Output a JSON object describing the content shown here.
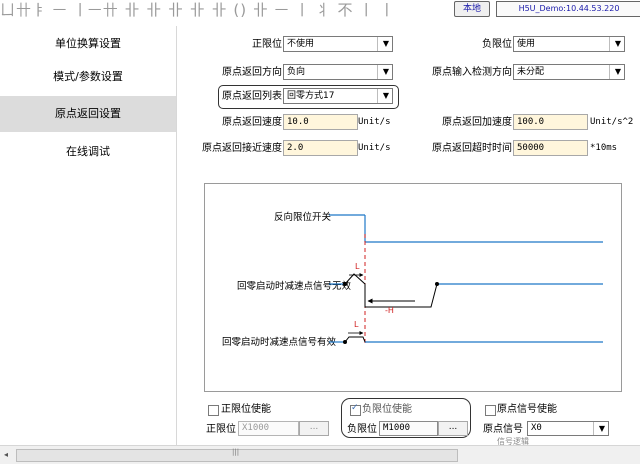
{
  "topbar": {
    "glyph_strip": "ㄩ卄ㅑ ㅡ ㅣㅡ卄 卝 卝 卝 卝 卝 () 卝 ㅡ ㅣ 丬 不 ㅣ ㅣ",
    "local_button": "本地",
    "device_label": "H5U_Demo:10.44.53.220"
  },
  "sidebar": {
    "items": [
      {
        "label": "单位换算设置"
      },
      {
        "label": "模式/参数设置"
      },
      {
        "label": "原点返回设置"
      },
      {
        "label": "在线调试"
      }
    ],
    "active_index": 2
  },
  "form": {
    "pos_limit_label": "正限位",
    "pos_limit_value": "不使用",
    "neg_limit_label": "负限位",
    "neg_limit_value": "使用",
    "home_dir_label": "原点返回方向",
    "home_dir_value": "负向",
    "origin_input_dir_label": "原点输入检测方向",
    "origin_input_dir_value": "未分配",
    "home_list_label": "原点返回列表",
    "home_list_value": "回零方式17",
    "home_speed_label": "原点返回速度",
    "home_speed_value": "10.0",
    "home_speed_unit": "Unit/s",
    "home_accel_label": "原点返回加速度",
    "home_accel_value": "100.0",
    "home_accel_unit": "Unit/s^2",
    "approach_speed_label": "原点返回接近速度",
    "approach_speed_value": "2.0",
    "approach_speed_unit": "Unit/s",
    "timeout_label": "原点返回超时时间",
    "timeout_value": "50000",
    "timeout_unit": "*10ms"
  },
  "diagram": {
    "row1_label": "反向限位开关",
    "row2_label": "回零启动时减速点信号无效",
    "row3_label": "回零启动时减速点信号有效",
    "marker_L": "L",
    "marker_H": "-H"
  },
  "bottom": {
    "pos_enable_label": "正限位使能",
    "pos_enable_checked": false,
    "pos_limit_field_label": "正限位",
    "pos_limit_field_value": "X1000",
    "neg_enable_label": "负限位使能",
    "neg_enable_checked": true,
    "neg_limit_field_label": "负限位",
    "neg_limit_field_value": "M1000",
    "origin_enable_label": "原点信号使能",
    "origin_enable_checked": false,
    "origin_signal_label": "原点信号",
    "origin_signal_value": "X0",
    "ellipsis": "...",
    "cut_text": "信号逻辑"
  },
  "scrollbar": {
    "left_arrow": "◂",
    "grip": "|||"
  },
  "colors": {
    "signal_line": "#1f78c8",
    "marker": "#d02020",
    "input_fill": "#fff6dc",
    "active_nav": "#dcdcdc"
  }
}
